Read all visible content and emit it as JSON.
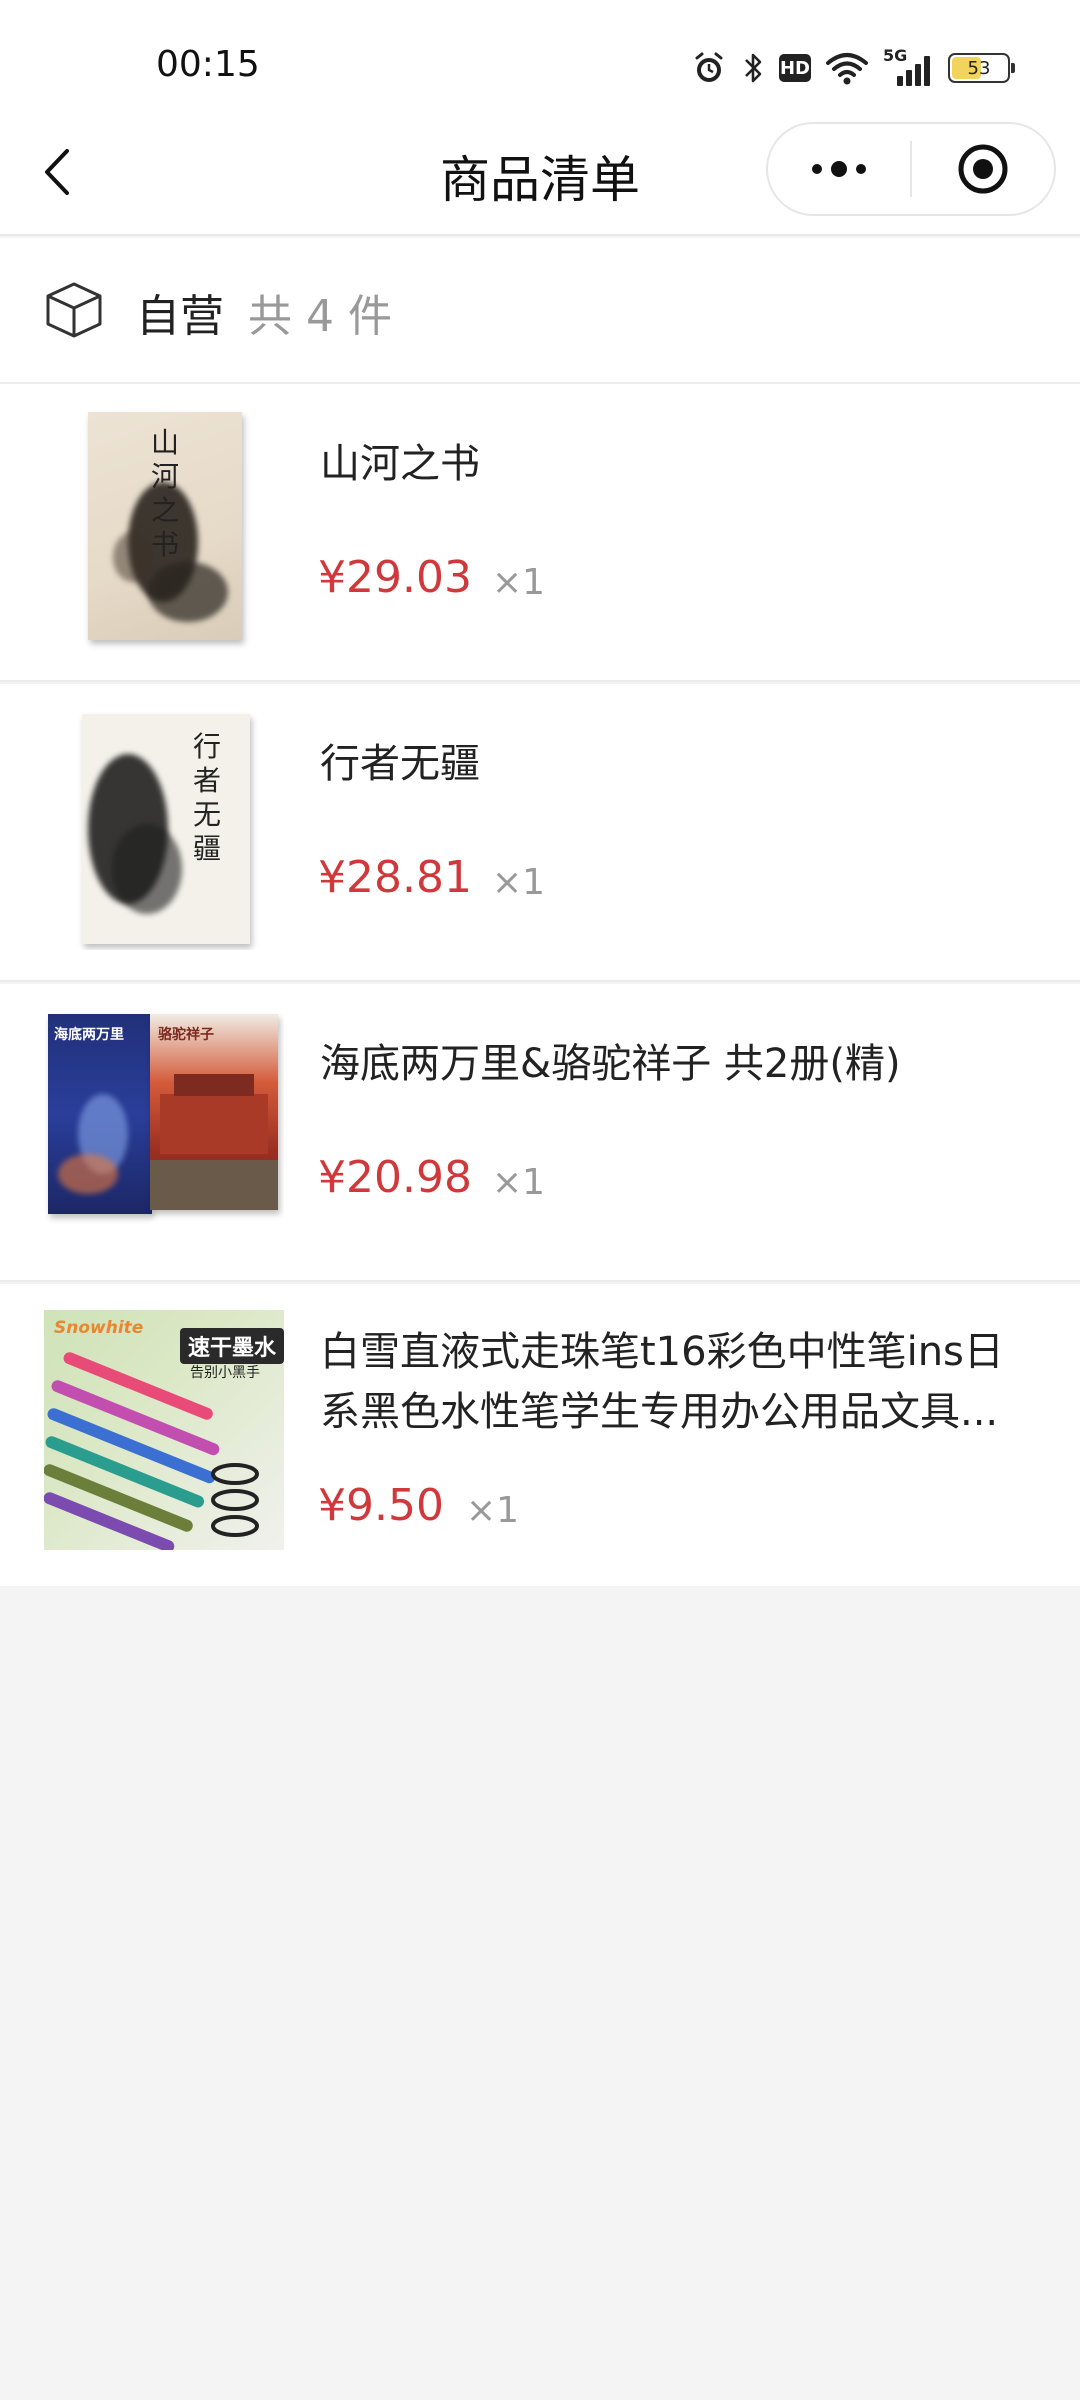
{
  "status_bar": {
    "time": "00:15",
    "network": "5G",
    "hd": "HD",
    "battery": "53",
    "battery_level": 0.53
  },
  "nav": {
    "title": "商品清单",
    "icons": [
      "back-arrow-icon",
      "more-dots-icon",
      "close-target-icon"
    ]
  },
  "store": {
    "name": "自营",
    "count_text": "共 4 件",
    "icon": "package-box-icon"
  },
  "items": [
    {
      "title": "山河之书",
      "price": "¥29.03",
      "qty": "×1",
      "cover_text": "山河之书"
    },
    {
      "title": "行者无疆",
      "price": "¥28.81",
      "qty": "×1",
      "cover_text": "行者无疆"
    },
    {
      "title": "海底两万里&骆驼祥子 共2册(精)",
      "price": "¥20.98",
      "qty": "×1",
      "cover_text_a": "海底两万里",
      "cover_text_b": "骆驼祥子"
    },
    {
      "title": "白雪直液式走珠笔t16彩色中性笔ins日系黑色水性笔学生专用办公用品文具...",
      "price": "¥9.50",
      "qty": "×1",
      "badge": "速干墨水",
      "badge_sub": "告别小黑手",
      "brand": "Snowhite"
    }
  ],
  "colors": {
    "price": "#d0393b",
    "muted": "#999999",
    "background": "#f4f4f4"
  }
}
